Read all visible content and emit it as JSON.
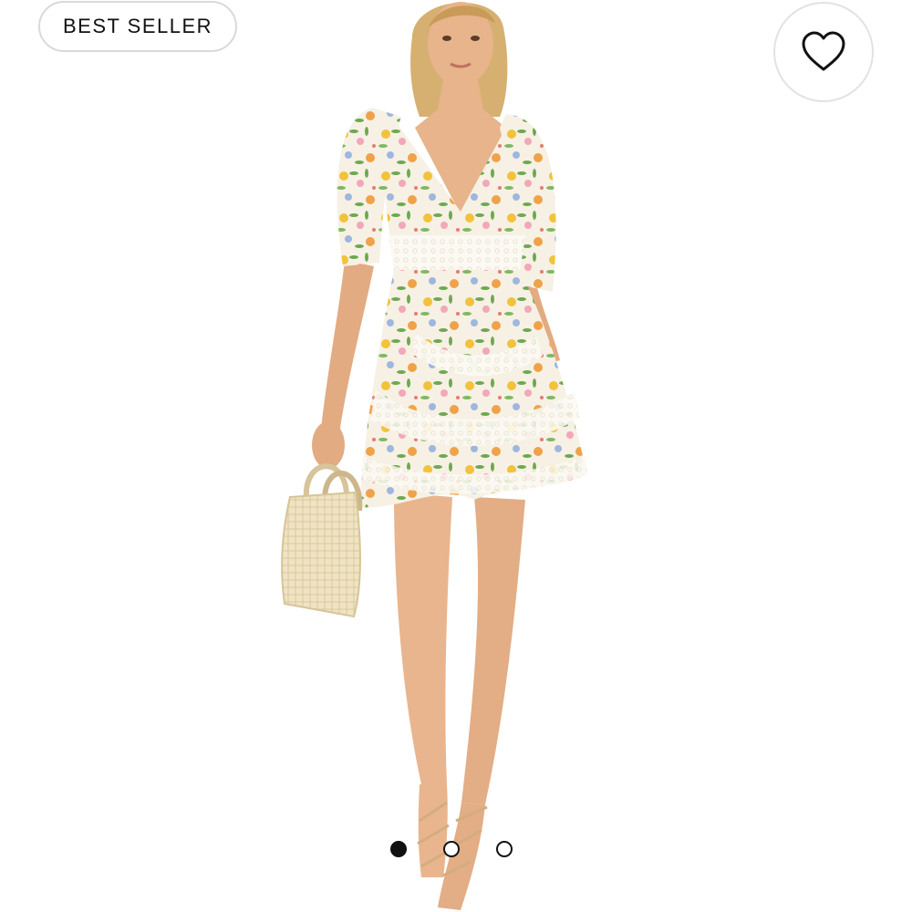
{
  "badge": {
    "label": "BEST SELLER"
  },
  "favorite": {
    "icon": "heart-outline-icon"
  },
  "gallery": {
    "image": "model-floral-mini-dress-photo",
    "dots": [
      {
        "state": "active"
      },
      {
        "state": "inactive"
      },
      {
        "state": "inactive"
      }
    ]
  },
  "colors": {
    "dress_cream": "#f6f1e4",
    "floral_yellow": "#f2c23c",
    "floral_orange": "#f0a24a",
    "floral_pink": "#f3a7b8",
    "floral_green": "#6ea851",
    "skin": "#e7b48c",
    "hair": "#d6b071",
    "bag": "#eadcb8"
  }
}
